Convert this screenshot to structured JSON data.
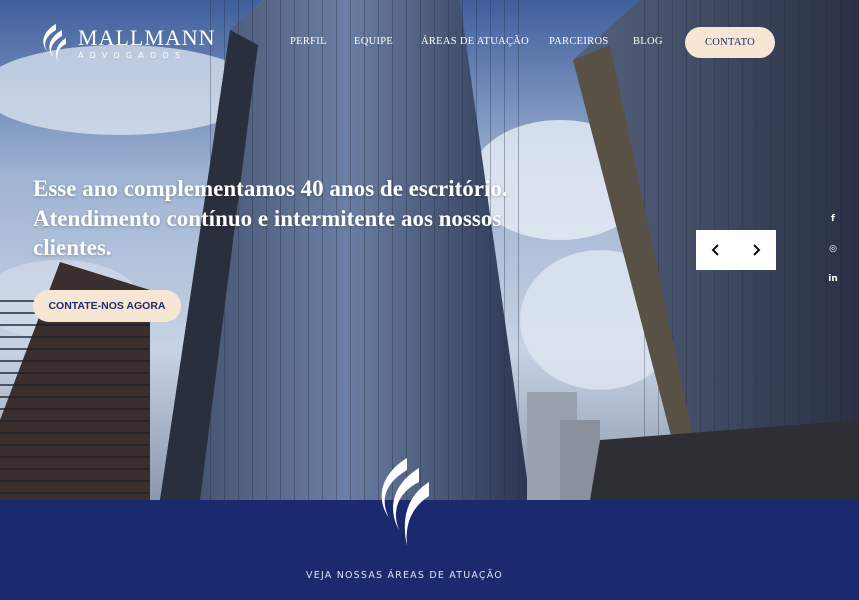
{
  "brand": {
    "name": "MALLMANN",
    "tagline": "ADVOGADOS"
  },
  "nav": {
    "items": [
      "PERFIL",
      "EQUIPE",
      "ÁREAS DE ATUAÇÃO",
      "PARCEIROS",
      "BLOG"
    ],
    "contact_label": "CONTATO"
  },
  "hero": {
    "headline": "Esse ano complementamos 40 anos de escritório. Atendimento contínuo e intermitente aos nossos clientes.",
    "cta_label": "CONTATE-NOS AGORA",
    "slider": {
      "prev_icon": "chevron-left-icon",
      "next_icon": "chevron-right-icon"
    }
  },
  "social": [
    {
      "icon": "facebook-icon",
      "glyph": "f"
    },
    {
      "icon": "instagram-icon",
      "glyph": "◎"
    },
    {
      "icon": "linkedin-icon",
      "glyph": "in"
    }
  ],
  "band": {
    "text": "VEJA NOSSAS ÁREAS DE ATUAÇÃO"
  },
  "colors": {
    "navy": "#1b2a6e",
    "cream": "#f7e6d3",
    "white": "#ffffff"
  }
}
